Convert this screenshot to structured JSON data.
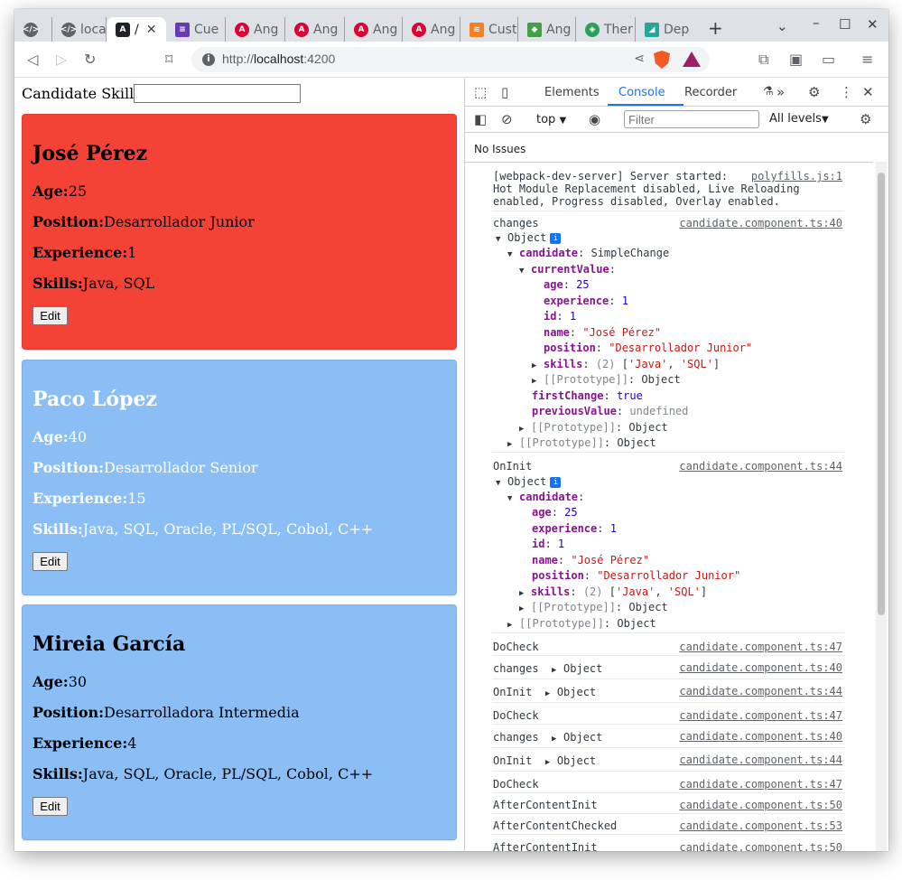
{
  "browser": {
    "tabs": [
      {
        "label": "",
        "icon": "devtools-icon"
      },
      {
        "label": "loca",
        "icon": "devtools-icon"
      },
      {
        "label": "/",
        "icon": "angular-icon"
      },
      {
        "label": "Cue",
        "icon": "forms-icon"
      },
      {
        "label": "Ang",
        "icon": "angular-icon"
      },
      {
        "label": "Ang",
        "icon": "angular-icon"
      },
      {
        "label": "Ang",
        "icon": "angular-icon"
      },
      {
        "label": "Ang",
        "icon": "angular-icon"
      },
      {
        "label": "Cust",
        "icon": "stack-icon"
      },
      {
        "label": "Ang",
        "icon": "cube-icon"
      },
      {
        "label": "Ther",
        "icon": "code-icon"
      },
      {
        "label": "Dep",
        "icon": "deploy-icon"
      }
    ],
    "url_scheme": "http://",
    "url_host": "localhost",
    "url_port": ":4200"
  },
  "page": {
    "skill_label": "Candidate Skill",
    "skill_value": "",
    "age_label": "Age:",
    "position_label": "Position:",
    "experience_label": "Experience:",
    "skills_label": "Skills:",
    "edit_label": "Edit",
    "candidates": [
      {
        "name": "José Pérez",
        "age": "25",
        "position": "Desarrollador Junior",
        "experience": "1",
        "skills": "Java, SQL",
        "bg": "#f44336",
        "fg": "#000000"
      },
      {
        "name": "Paco López",
        "age": "40",
        "position": "Desarrollador Senior",
        "experience": "15",
        "skills": "Java, SQL, Oracle, PL/SQL, Cobol, C++",
        "bg": "#8bbef5",
        "fg": "#ffffff"
      },
      {
        "name": "Mireia García",
        "age": "30",
        "position": "Desarrolladora Intermedia",
        "experience": "4",
        "skills": "Java, SQL, Oracle, PL/SQL, Cobol, C++",
        "bg": "#8bbef5",
        "fg": "#000000"
      }
    ]
  },
  "devtools": {
    "tabs": [
      "Elements",
      "Console",
      "Recorder"
    ],
    "context": "top",
    "filter_placeholder": "Filter",
    "levels": "All levels",
    "issues": "No Issues",
    "server_msg_1": "[webpack-dev-server] Server started:",
    "server_msg_2": "Hot Module Replacement disabled, Live Reloading",
    "server_msg_3": "enabled, Progress disabled, Overlay enabled.",
    "server_src": "polyfills.js:1",
    "src_40": "candidate.component.ts:40",
    "src_44": "candidate.component.ts:44",
    "src_47": "candidate.component.ts:47",
    "src_50": "candidate.component.ts:50",
    "src_53": "candidate.component.ts:53",
    "w_changes": "changes",
    "w_oninit": "OnInit",
    "w_docheck": "DoCheck",
    "w_aci": "AfterContentInit",
    "w_acc": "AfterContentChecked",
    "w_object": "Object",
    "k_candidate": "candidate",
    "v_simplechange": "SimpleChange",
    "k_currentValue": "currentValue",
    "k_age": "age",
    "v_age": "25",
    "k_experience": "experience",
    "v_experience": "1",
    "k_id": "id",
    "v_id": "1",
    "k_name": "name",
    "v_name": "\"José Pérez\"",
    "k_position": "position",
    "v_position": "\"Desarrollador Junior\"",
    "k_skills": "skills",
    "v_skills_count": "(2)",
    "v_skills_java": "'Java'",
    "v_skills_sql": "'SQL'",
    "k_proto": "[[Prototype]]",
    "k_firstChange": "firstChange",
    "v_true": "true",
    "k_previousValue": "previousValue",
    "v_undefined": "undefined"
  }
}
